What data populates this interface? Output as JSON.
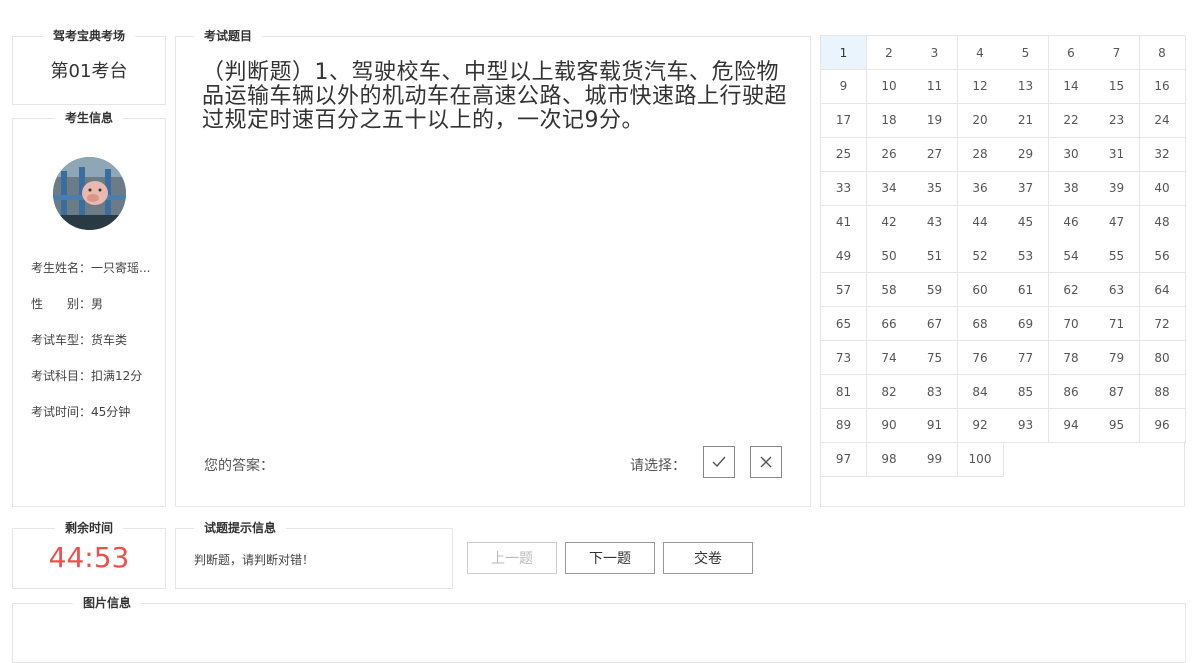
{
  "venue": {
    "legend": "驾考宝典考场",
    "seat": "第01考台"
  },
  "student": {
    "legend": "考生信息",
    "rows": [
      {
        "label": "考生姓名：",
        "value": "一只寄瑶..."
      },
      {
        "label": "性　　别：",
        "value": "男"
      },
      {
        "label": "考试车型：",
        "value": "货车类"
      },
      {
        "label": "考试科目：",
        "value": "扣满12分"
      },
      {
        "label": "考试时间：",
        "value": "45分钟"
      }
    ]
  },
  "question": {
    "legend": "考试题目",
    "text": "（判断题）1、驾驶校车、中型以上载客载货汽车、危险物品运输车辆以外的机动车在高速公路、城市快速路上行驶超过规定时速百分之五十以上的，一次记9分。",
    "answer_label": "您的答案：",
    "answer_value": "",
    "choose_label": "请选择：",
    "buttons": [
      {
        "icon": "check-icon"
      },
      {
        "icon": "cross-icon"
      }
    ]
  },
  "grid": {
    "active": 1,
    "numbers": [
      "1",
      "2",
      "3",
      "4",
      "5",
      "6",
      "7",
      "8",
      "9",
      "10",
      "11",
      "12",
      "13",
      "14",
      "15",
      "16",
      "17",
      "18",
      "19",
      "20",
      "21",
      "22",
      "23",
      "24",
      "25",
      "26",
      "27",
      "28",
      "29",
      "30",
      "31",
      "32",
      "33",
      "34",
      "35",
      "36",
      "37",
      "38",
      "39",
      "40",
      "41",
      "42",
      "43",
      "44",
      "45",
      "46",
      "47",
      "48",
      "49",
      "50",
      "51",
      "52",
      "53",
      "54",
      "55",
      "56",
      "57",
      "58",
      "59",
      "60",
      "61",
      "62",
      "63",
      "64",
      "65",
      "66",
      "67",
      "68",
      "69",
      "70",
      "71",
      "72",
      "73",
      "74",
      "75",
      "76",
      "77",
      "78",
      "79",
      "80",
      "81",
      "82",
      "83",
      "84",
      "85",
      "86",
      "87",
      "88",
      "89",
      "90",
      "91",
      "92",
      "93",
      "94",
      "95",
      "96",
      "97",
      "98",
      "99",
      "100"
    ]
  },
  "timer": {
    "legend": "剩余时间",
    "value": "44:53",
    "color": "#f0504a"
  },
  "hint": {
    "legend": "试题提示信息",
    "text": "判断题，请判断对错！"
  },
  "nav": {
    "prev": "上一题",
    "next": "下一题",
    "submit": "交卷"
  },
  "image_info": {
    "legend": "图片信息"
  }
}
